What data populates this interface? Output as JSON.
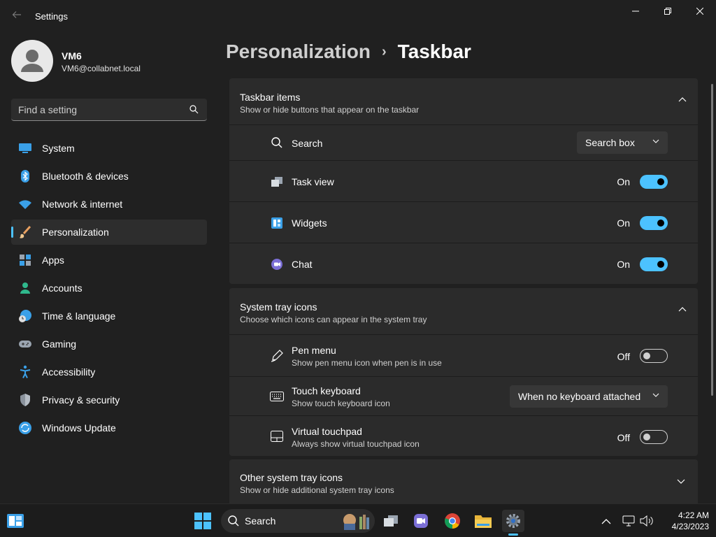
{
  "app": {
    "title": "Settings"
  },
  "profile": {
    "name": "VM6",
    "email": "VM6@collabnet.local"
  },
  "search": {
    "placeholder": "Find a setting"
  },
  "sidebar": {
    "items": [
      {
        "label": "System",
        "icon": "system-icon"
      },
      {
        "label": "Bluetooth & devices",
        "icon": "bluetooth-icon"
      },
      {
        "label": "Network & internet",
        "icon": "wifi-icon"
      },
      {
        "label": "Personalization",
        "icon": "brush-icon",
        "active": true
      },
      {
        "label": "Apps",
        "icon": "apps-icon"
      },
      {
        "label": "Accounts",
        "icon": "accounts-icon"
      },
      {
        "label": "Time & language",
        "icon": "globe-clock-icon"
      },
      {
        "label": "Gaming",
        "icon": "gamepad-icon"
      },
      {
        "label": "Accessibility",
        "icon": "accessibility-icon"
      },
      {
        "label": "Privacy & security",
        "icon": "shield-icon"
      },
      {
        "label": "Windows Update",
        "icon": "update-icon"
      }
    ]
  },
  "breadcrumb": {
    "parent": "Personalization",
    "separator": "›",
    "current": "Taskbar"
  },
  "taskbar_items": {
    "title": "Taskbar items",
    "description": "Show or hide buttons that appear on the taskbar",
    "rows": [
      {
        "label": "Search",
        "control": "dropdown",
        "value": "Search box"
      },
      {
        "label": "Task view",
        "control": "toggle",
        "state": "On",
        "on": true
      },
      {
        "label": "Widgets",
        "control": "toggle",
        "state": "On",
        "on": true
      },
      {
        "label": "Chat",
        "control": "toggle",
        "state": "On",
        "on": true
      }
    ]
  },
  "system_tray": {
    "title": "System tray icons",
    "description": "Choose which icons can appear in the system tray",
    "rows": [
      {
        "label": "Pen menu",
        "description": "Show pen menu icon when pen is in use",
        "control": "toggle",
        "state": "Off",
        "on": false
      },
      {
        "label": "Touch keyboard",
        "description": "Show touch keyboard icon",
        "control": "dropdown",
        "value": "When no keyboard attached"
      },
      {
        "label": "Virtual touchpad",
        "description": "Always show virtual touchpad icon",
        "control": "toggle",
        "state": "Off",
        "on": false
      }
    ]
  },
  "other_tray": {
    "title": "Other system tray icons",
    "description": "Show or hide additional system tray icons"
  },
  "taskbar": {
    "search_label": "Search",
    "time": "4:22 AM",
    "date": "4/23/2023"
  },
  "colors": {
    "accent": "#4cc2ff",
    "background": "#202020",
    "card": "#2b2b2b"
  }
}
